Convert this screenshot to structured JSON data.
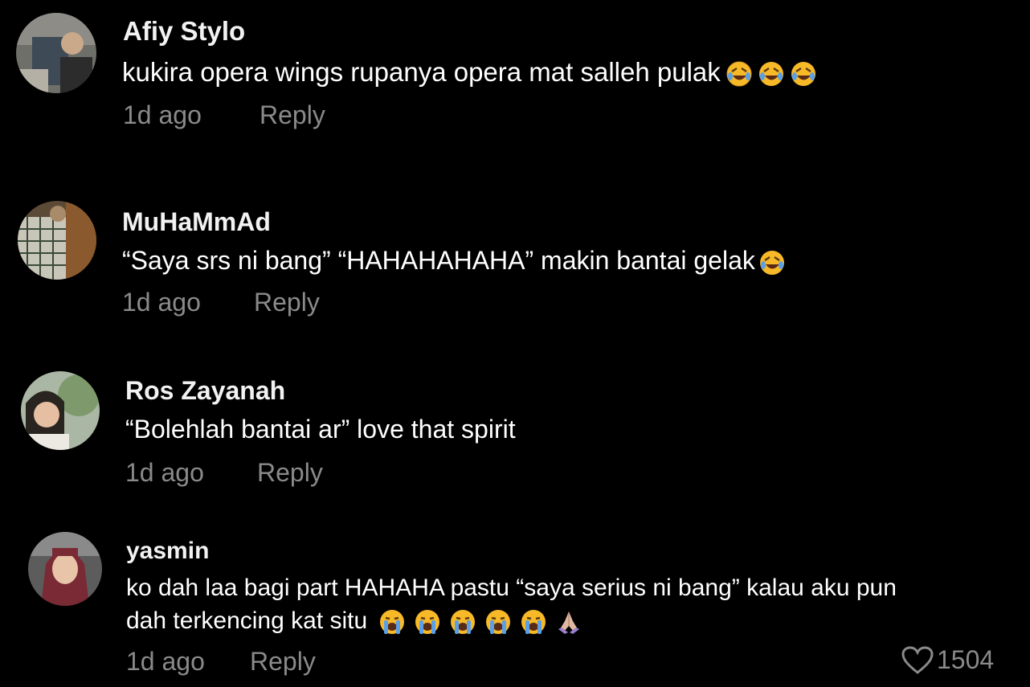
{
  "colors": {
    "background": "#000000",
    "username": "#f2f2f2",
    "text": "#ffffff",
    "meta": "#8a8a8a"
  },
  "comments": [
    {
      "username": "Afiy Stylo",
      "text": "kukira opera wings rupanya opera mat salleh pulak",
      "emojis": [
        "rofl-icon",
        "rofl-icon",
        "rofl-icon"
      ],
      "time": "1d ago",
      "reply_label": "Reply"
    },
    {
      "username": "MuHaMmAd",
      "text": "“Saya srs ni bang” “HAHAHAHAHA” makin bantai gelak",
      "emojis": [
        "rofl-icon"
      ],
      "time": "1d ago",
      "reply_label": "Reply"
    },
    {
      "username": "Ros Zayanah",
      "text": "“Bolehlah bantai ar” love that spirit",
      "emojis": [],
      "time": "1d ago",
      "reply_label": "Reply"
    },
    {
      "username": "yasmin",
      "text_line1": "ko dah laa bagi part HAHAHA pastu “saya serius ni bang” kalau aku pun",
      "text_line2": "dah terkencing kat situ",
      "emojis": [
        "crying-face-icon",
        "crying-face-icon",
        "crying-face-icon",
        "crying-face-icon",
        "crying-face-icon",
        "folded-hands-icon"
      ],
      "time": "1d ago",
      "reply_label": "Reply",
      "like_count": "1504"
    }
  ]
}
